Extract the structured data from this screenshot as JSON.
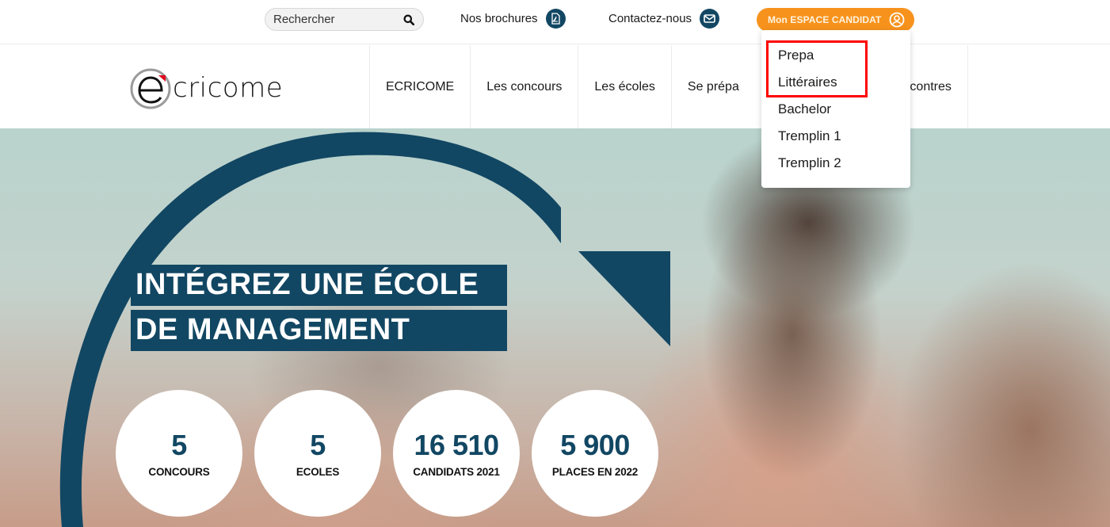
{
  "topbar": {
    "search": {
      "placeholder": "Rechercher",
      "value": "",
      "icon": "search-icon"
    },
    "brochures": {
      "label": "Nos brochures",
      "icon": "pdf-icon"
    },
    "contact": {
      "label": "Contactez-nous",
      "icon": "envelope-icon"
    },
    "espace_candidat": {
      "label": "Mon ESPACE CANDIDAT",
      "icon": "user-circle-icon"
    }
  },
  "logo": {
    "text": "cricome",
    "initial": "e",
    "brand": "Ecricome"
  },
  "nav": {
    "items": [
      {
        "label": "ECRICOME"
      },
      {
        "label": "Les concours"
      },
      {
        "label": "Les écoles"
      },
      {
        "label": "Se prépa"
      },
      {
        "label": ""
      },
      {
        "label": "ncontres"
      }
    ]
  },
  "dropdown": {
    "items": [
      {
        "label": "Prepa"
      },
      {
        "label": "Littéraires"
      },
      {
        "label": "Bachelor"
      },
      {
        "label": "Tremplin 1"
      },
      {
        "label": "Tremplin 2"
      }
    ],
    "highlighted": [
      "Prepa",
      "Littéraires"
    ]
  },
  "hero": {
    "headline_line1": "INTÉGREZ UNE ÉCOLE",
    "headline_line2": "DE MANAGEMENT",
    "stats": [
      {
        "value": "5",
        "label": "CONCOURS"
      },
      {
        "value": "5",
        "label": "ECOLES"
      },
      {
        "value": "16 510",
        "label": "CANDIDATS 2021"
      },
      {
        "value": "5 900",
        "label": "PLACES EN 2022"
      }
    ]
  },
  "colors": {
    "brand_blue": "#124763",
    "accent_orange": "#f7931d",
    "logo_red": "#e3001b",
    "highlight_red": "#ff0000"
  }
}
